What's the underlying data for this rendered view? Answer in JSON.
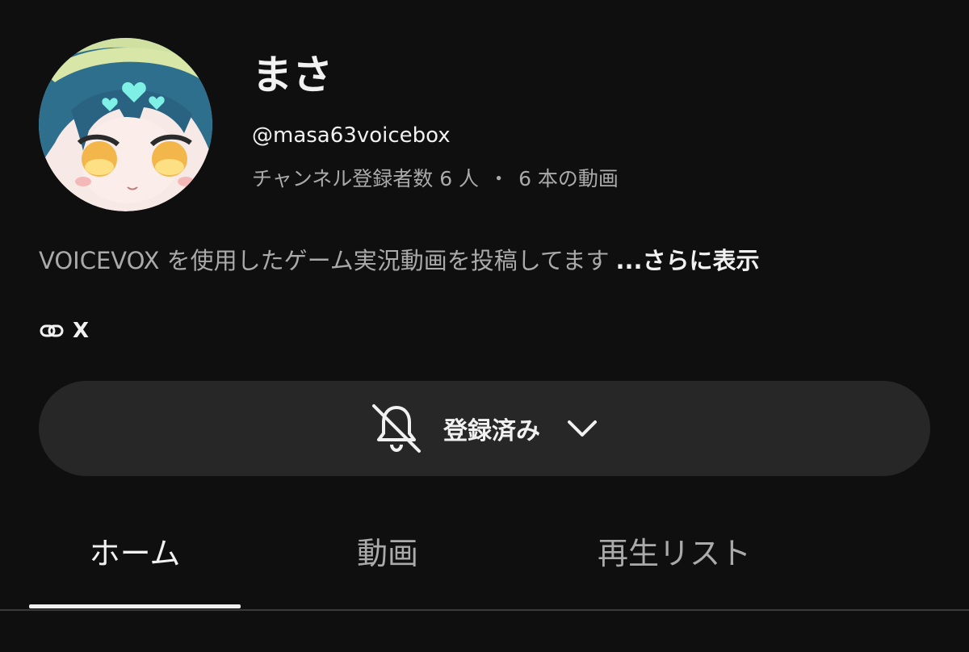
{
  "channel": {
    "name": "まさ",
    "handle": "@masa63voicebox",
    "subscribers": "チャンネル登録者数 6 人",
    "separator": "・",
    "video_count": "6 本の動画",
    "description": "VOICEVOX を使用したゲーム実況動画を投稿してます",
    "more_label": "...さらに表示",
    "link_label": "X",
    "link_icon": "link-icon",
    "avatar_icon": "avatar-illustration"
  },
  "subscribe_button": {
    "label": "登録済み",
    "bell_icon": "bell-off-icon",
    "chevron_icon": "chevron-down-icon"
  },
  "tabs": [
    {
      "label": "ホーム",
      "active": true
    },
    {
      "label": "動画",
      "active": false
    },
    {
      "label": "再生リスト",
      "active": false
    }
  ],
  "colors": {
    "background": "#0f0f0f",
    "text_primary": "#f1f1f1",
    "text_secondary": "#aaaaaa",
    "button_bg": "#272727"
  }
}
